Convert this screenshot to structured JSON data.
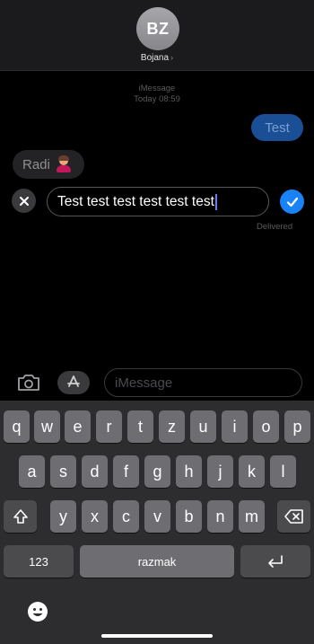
{
  "header": {
    "avatar_initials": "BZ",
    "contact_name": "Bojana",
    "chevron": "›"
  },
  "thread": {
    "service": "iMessage",
    "timestamp": "Today 08:59",
    "outgoing_text": "Test",
    "incoming_text": "Radi",
    "incoming_emoji": "woman-shrugging-emoji",
    "edit_text": "Test test test test test test",
    "status": "Delivered"
  },
  "compose": {
    "placeholder": "iMessage"
  },
  "keyboard": {
    "row1": [
      "q",
      "w",
      "e",
      "r",
      "t",
      "z",
      "u",
      "i",
      "o",
      "p"
    ],
    "row2": [
      "a",
      "s",
      "d",
      "f",
      "g",
      "h",
      "j",
      "k",
      "l"
    ],
    "row3": [
      "y",
      "x",
      "c",
      "v",
      "b",
      "n",
      "m"
    ],
    "numbers_label": "123",
    "space_label": "razmak"
  },
  "icons": {
    "cancel": "close-icon",
    "confirm": "checkmark-icon",
    "camera": "camera-icon",
    "apps": "app-store-icon",
    "shift": "shift-icon",
    "backspace": "backspace-icon",
    "return": "return-icon",
    "emoji": "emoji-icon"
  },
  "colors": {
    "accent_blue": "#1a82f7",
    "outgoing_bubble": "#1a4f96",
    "key_letter": "#6e6e72",
    "key_function": "#4b4b4e",
    "keyboard_bg": "#2d2d2f"
  }
}
